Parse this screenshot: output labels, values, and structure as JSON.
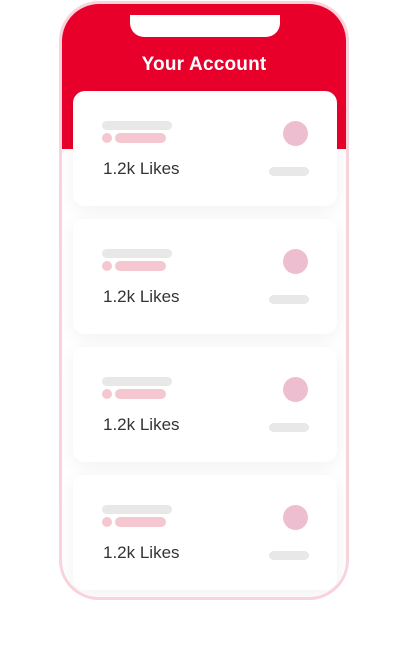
{
  "header": {
    "title": "Your Account"
  },
  "cards": [
    {
      "likes_label": "1.2k Likes"
    },
    {
      "likes_label": "1.2k Likes"
    },
    {
      "likes_label": "1.2k Likes"
    },
    {
      "likes_label": "1.2k Likes"
    }
  ],
  "colors": {
    "accent": "#e8002b",
    "phone_border": "#f8d3dc",
    "placeholder_grey": "#e8e8e8",
    "placeholder_pink": "#f5c7d1",
    "avatar": "#edbed0"
  }
}
